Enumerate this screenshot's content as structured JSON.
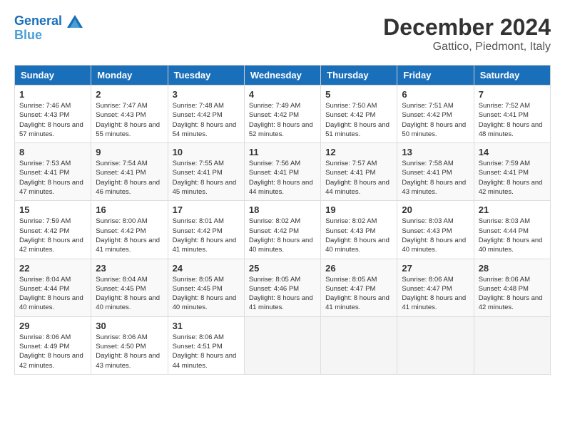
{
  "logo": {
    "line1": "General",
    "line2": "Blue"
  },
  "title": "December 2024",
  "location": "Gattico, Piedmont, Italy",
  "days_header": [
    "Sunday",
    "Monday",
    "Tuesday",
    "Wednesday",
    "Thursday",
    "Friday",
    "Saturday"
  ],
  "weeks": [
    [
      {
        "day": "1",
        "sunrise": "Sunrise: 7:46 AM",
        "sunset": "Sunset: 4:43 PM",
        "daylight": "Daylight: 8 hours and 57 minutes."
      },
      {
        "day": "2",
        "sunrise": "Sunrise: 7:47 AM",
        "sunset": "Sunset: 4:43 PM",
        "daylight": "Daylight: 8 hours and 55 minutes."
      },
      {
        "day": "3",
        "sunrise": "Sunrise: 7:48 AM",
        "sunset": "Sunset: 4:42 PM",
        "daylight": "Daylight: 8 hours and 54 minutes."
      },
      {
        "day": "4",
        "sunrise": "Sunrise: 7:49 AM",
        "sunset": "Sunset: 4:42 PM",
        "daylight": "Daylight: 8 hours and 52 minutes."
      },
      {
        "day": "5",
        "sunrise": "Sunrise: 7:50 AM",
        "sunset": "Sunset: 4:42 PM",
        "daylight": "Daylight: 8 hours and 51 minutes."
      },
      {
        "day": "6",
        "sunrise": "Sunrise: 7:51 AM",
        "sunset": "Sunset: 4:42 PM",
        "daylight": "Daylight: 8 hours and 50 minutes."
      },
      {
        "day": "7",
        "sunrise": "Sunrise: 7:52 AM",
        "sunset": "Sunset: 4:41 PM",
        "daylight": "Daylight: 8 hours and 48 minutes."
      }
    ],
    [
      {
        "day": "8",
        "sunrise": "Sunrise: 7:53 AM",
        "sunset": "Sunset: 4:41 PM",
        "daylight": "Daylight: 8 hours and 47 minutes."
      },
      {
        "day": "9",
        "sunrise": "Sunrise: 7:54 AM",
        "sunset": "Sunset: 4:41 PM",
        "daylight": "Daylight: 8 hours and 46 minutes."
      },
      {
        "day": "10",
        "sunrise": "Sunrise: 7:55 AM",
        "sunset": "Sunset: 4:41 PM",
        "daylight": "Daylight: 8 hours and 45 minutes."
      },
      {
        "day": "11",
        "sunrise": "Sunrise: 7:56 AM",
        "sunset": "Sunset: 4:41 PM",
        "daylight": "Daylight: 8 hours and 44 minutes."
      },
      {
        "day": "12",
        "sunrise": "Sunrise: 7:57 AM",
        "sunset": "Sunset: 4:41 PM",
        "daylight": "Daylight: 8 hours and 44 minutes."
      },
      {
        "day": "13",
        "sunrise": "Sunrise: 7:58 AM",
        "sunset": "Sunset: 4:41 PM",
        "daylight": "Daylight: 8 hours and 43 minutes."
      },
      {
        "day": "14",
        "sunrise": "Sunrise: 7:59 AM",
        "sunset": "Sunset: 4:41 PM",
        "daylight": "Daylight: 8 hours and 42 minutes."
      }
    ],
    [
      {
        "day": "15",
        "sunrise": "Sunrise: 7:59 AM",
        "sunset": "Sunset: 4:42 PM",
        "daylight": "Daylight: 8 hours and 42 minutes."
      },
      {
        "day": "16",
        "sunrise": "Sunrise: 8:00 AM",
        "sunset": "Sunset: 4:42 PM",
        "daylight": "Daylight: 8 hours and 41 minutes."
      },
      {
        "day": "17",
        "sunrise": "Sunrise: 8:01 AM",
        "sunset": "Sunset: 4:42 PM",
        "daylight": "Daylight: 8 hours and 41 minutes."
      },
      {
        "day": "18",
        "sunrise": "Sunrise: 8:02 AM",
        "sunset": "Sunset: 4:42 PM",
        "daylight": "Daylight: 8 hours and 40 minutes."
      },
      {
        "day": "19",
        "sunrise": "Sunrise: 8:02 AM",
        "sunset": "Sunset: 4:43 PM",
        "daylight": "Daylight: 8 hours and 40 minutes."
      },
      {
        "day": "20",
        "sunrise": "Sunrise: 8:03 AM",
        "sunset": "Sunset: 4:43 PM",
        "daylight": "Daylight: 8 hours and 40 minutes."
      },
      {
        "day": "21",
        "sunrise": "Sunrise: 8:03 AM",
        "sunset": "Sunset: 4:44 PM",
        "daylight": "Daylight: 8 hours and 40 minutes."
      }
    ],
    [
      {
        "day": "22",
        "sunrise": "Sunrise: 8:04 AM",
        "sunset": "Sunset: 4:44 PM",
        "daylight": "Daylight: 8 hours and 40 minutes."
      },
      {
        "day": "23",
        "sunrise": "Sunrise: 8:04 AM",
        "sunset": "Sunset: 4:45 PM",
        "daylight": "Daylight: 8 hours and 40 minutes."
      },
      {
        "day": "24",
        "sunrise": "Sunrise: 8:05 AM",
        "sunset": "Sunset: 4:45 PM",
        "daylight": "Daylight: 8 hours and 40 minutes."
      },
      {
        "day": "25",
        "sunrise": "Sunrise: 8:05 AM",
        "sunset": "Sunset: 4:46 PM",
        "daylight": "Daylight: 8 hours and 41 minutes."
      },
      {
        "day": "26",
        "sunrise": "Sunrise: 8:05 AM",
        "sunset": "Sunset: 4:47 PM",
        "daylight": "Daylight: 8 hours and 41 minutes."
      },
      {
        "day": "27",
        "sunrise": "Sunrise: 8:06 AM",
        "sunset": "Sunset: 4:47 PM",
        "daylight": "Daylight: 8 hours and 41 minutes."
      },
      {
        "day": "28",
        "sunrise": "Sunrise: 8:06 AM",
        "sunset": "Sunset: 4:48 PM",
        "daylight": "Daylight: 8 hours and 42 minutes."
      }
    ],
    [
      {
        "day": "29",
        "sunrise": "Sunrise: 8:06 AM",
        "sunset": "Sunset: 4:49 PM",
        "daylight": "Daylight: 8 hours and 42 minutes."
      },
      {
        "day": "30",
        "sunrise": "Sunrise: 8:06 AM",
        "sunset": "Sunset: 4:50 PM",
        "daylight": "Daylight: 8 hours and 43 minutes."
      },
      {
        "day": "31",
        "sunrise": "Sunrise: 8:06 AM",
        "sunset": "Sunset: 4:51 PM",
        "daylight": "Daylight: 8 hours and 44 minutes."
      },
      null,
      null,
      null,
      null
    ]
  ]
}
